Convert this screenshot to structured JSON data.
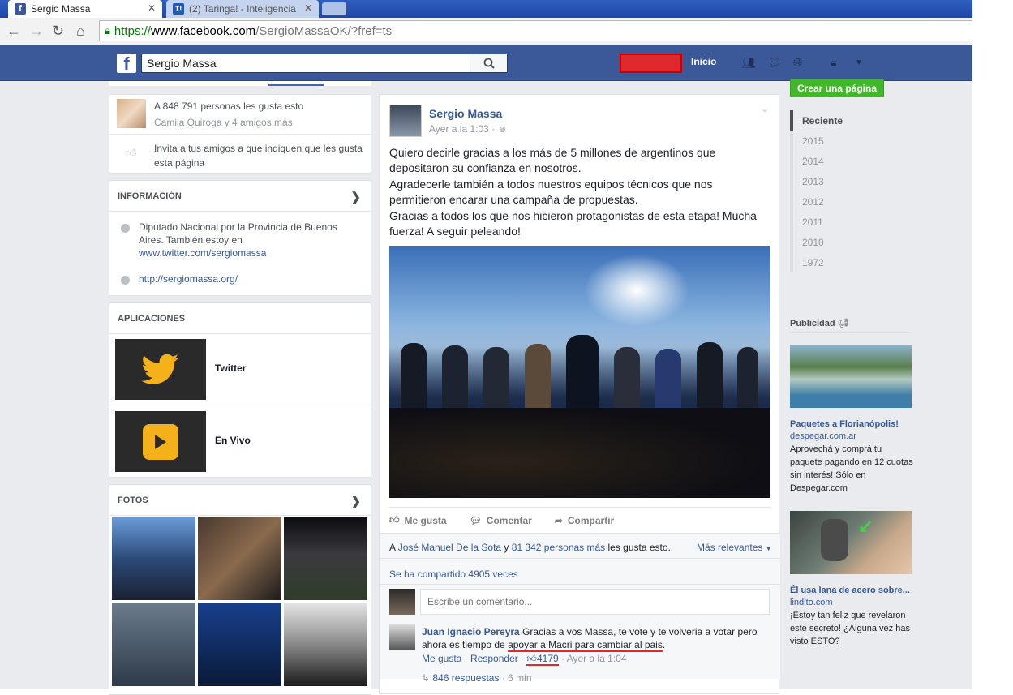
{
  "browser": {
    "tabs": [
      {
        "label": "Sergio Massa"
      },
      {
        "label": "(2) Taringa! - Inteligencia"
      }
    ],
    "url": {
      "scheme": "https://",
      "host": "www.facebook.com",
      "path": "/SergioMassaOK/?fref=ts"
    }
  },
  "fb_header": {
    "search_value": "Sergio Massa",
    "home_label": "Inicio"
  },
  "left": {
    "likes_count_text": "A 848 791 personas les gusta esto",
    "friends_like_text": "Camila Quiroga y 4 amigos más",
    "invite_text": "Invita a tus amigos a que indiquen que les gusta esta página",
    "info_header": "INFORMACIÓN",
    "info_description": "Diputado Nacional por la Provincia de Buenos Aires. También estoy en",
    "info_twitter": "www.twitter.com/sergiomassa",
    "info_website": "http://sergiomassa.org/",
    "apps_header": "APLICACIONES",
    "apps": [
      {
        "label": "Twitter"
      },
      {
        "label": "En Vivo"
      }
    ],
    "photos_header": "FOTOS"
  },
  "post": {
    "author": "Sergio Massa",
    "time": "Ayer a la 1:03 ·",
    "text": [
      "Quiero decirle gracias a los más de 5 millones de argentinos que depositaron su confianza en nosotros.",
      "Agradecerle también a todos nuestros equipos técnicos que nos permitieron encarar una campaña de propuestas.",
      "Gracias a todos los que nos hicieron protagonistas de esta etapa! Mucha fuerza! A seguir peleando!"
    ],
    "actions": {
      "like": "Me gusta",
      "comment": "Comentar",
      "share": "Compartir"
    },
    "likes_prefix": "A ",
    "likes_person": "José Manuel De la Sota",
    "likes_and": " y ",
    "likes_others": "81 342 personas más",
    "likes_suffix": " les gusta esto.",
    "sort_label": "Más relevantes",
    "shares_text": "Se ha compartido 4905 veces",
    "comment_placeholder": "Escribe un comentario...",
    "comment": {
      "author": "Juan Ignacio Pereyra",
      "text_start": " Gracias a vos Massa, te vote y te volveria a votar pero ahora es tiempo de ",
      "text_underlined": "apoyar a Macri para cambiar al pais",
      "text_end": ".",
      "like_label": "Me gusta",
      "reply_label": "Responder",
      "like_count": "4179",
      "time": "Ayer a la 1:04",
      "replies": "846 respuestas",
      "replies_time": "· 6 min"
    }
  },
  "right": {
    "create_page": "Crear una página",
    "timeline": [
      "Reciente",
      "2015",
      "2014",
      "2013",
      "2012",
      "2011",
      "2010",
      "1972"
    ],
    "ads_header": "Publicidad",
    "ads": [
      {
        "title": "Paquetes a Florianópolis!",
        "domain": "despegar.com.ar",
        "body": "Aprovechá y comprá tu paquete pagando en 12 cuotas sin interés! Sólo en Despegar.com"
      },
      {
        "title": "Él usa lana de acero sobre...",
        "domain": "lindito.com",
        "body": "¡Estoy tan feliz que revelaron este secreto! ¿Alguna vez has visto ESTO?"
      }
    ]
  },
  "colors": {
    "fb_blue": "#3b5998",
    "link": "#365899",
    "green_button": "#42b72a",
    "annotation_red": "#e0282f"
  }
}
